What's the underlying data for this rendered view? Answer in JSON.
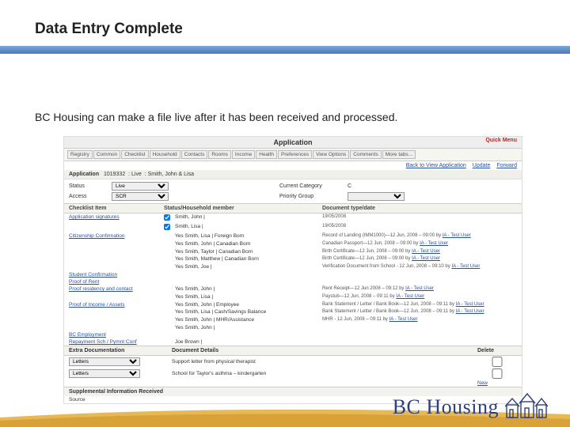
{
  "slide": {
    "title": "Data Entry Complete",
    "body": "BC Housing can make a file live after it has been received and processed."
  },
  "app": {
    "title": "Application",
    "quickMenu": "Quick Menu",
    "tabs": [
      "Registry",
      "Common",
      "Checklist",
      "Household",
      "Contacts",
      "Rooms",
      "Income",
      "Health",
      "Preferences",
      "View Options",
      "Comments",
      "More tabs..."
    ],
    "actions": {
      "back": "Back to View Application",
      "update": "Update",
      "forward": "Forward"
    },
    "info": {
      "label": "Application",
      "id": "1019332",
      "statusWord": "Live",
      "name": "Smith, John & Lisa"
    },
    "fields": {
      "statusLabel": "Status",
      "statusValue": "Live",
      "accessLabel": "Access",
      "accessValue": "SCR",
      "catLabel": "Current Category",
      "catValue": "C",
      "priorityLabel": "Priority Group",
      "priorityValue": ""
    }
  },
  "checklist": {
    "headers": {
      "item": "Checklist\nItem",
      "status": "Status/Household member",
      "doc": "Document type/date"
    },
    "rows": [
      {
        "label": "Application signatures",
        "members": [
          "Smith, John |",
          "Smith, Lisa |"
        ],
        "checks": [
          true,
          true
        ],
        "docs": [
          "19/05/2008",
          "19/05/2008"
        ]
      },
      {
        "label": "Citizenship Confirmation",
        "members": [
          "Yes   Smith, Lisa | Foreign Born",
          "Yes   Smith, John | Canadian Born",
          "Yes   Smith, Taylor | Canadian Born",
          "Yes   Smith, Matthew | Canadian Born",
          "Yes   Smith, Joe |"
        ],
        "docs": [
          "Record of Landing (IMM1000)—12 Jun, 2008 – 09:00 by  IA - Test User",
          "Canadian Passport—12 Jun, 2008 – 09:00 by  IA - Test User",
          "Birth Certificate—12 Jun, 2008 – 09:00 by  IA - Test User",
          "Birth Certificate—12 Jun, 2008 – 09:00 by  IA - Test User",
          "Verification Document from School - 12 Jun, 2008 – 09:10 by  IA - Test User"
        ]
      },
      {
        "label": "Student Confirmation",
        "members": [],
        "docs": []
      },
      {
        "label": "Proof of Rent",
        "members": [],
        "docs": []
      },
      {
        "label": "Proof residency and contact",
        "members": [
          "Yes   Smith, John |",
          "Yes   Smith, Lisa |"
        ],
        "docs": [
          "Rent Receipt—12 Jun 2008 – 09:12 by  IA - Test User",
          "Paystub—12 Jun, 2008 – 09:11 by  IA - Test User"
        ]
      },
      {
        "label": "Proof of Income / Assets",
        "members": [
          "Yes   Smith, John | Employee",
          "Yes   Smith, Lisa | Cash/Savings Balance",
          "Yes   Smith, John | MHR/Assistance",
          "Yes   Smith, John |"
        ],
        "docs": [
          "Bank Statement / Letter / Bank Book—12 Jun, 2008 – 09:11 by  IA - Test User",
          "Bank Statement / Letter / Bank Book—12 Jun, 2008 – 09:11 by  IA - Test User",
          "MHR - 12 Jun, 2008 – 09:11 by  IA - Test User",
          ""
        ]
      },
      {
        "label": "BC Employment",
        "members": [],
        "docs": []
      },
      {
        "label": "Repayment Sch / Pymnt Conf",
        "members": [
          "Joe Brown |"
        ],
        "docs": []
      }
    ]
  },
  "extraDoc": {
    "headers": {
      "type": "Extra Documentation",
      "details": "Document Details",
      "del": "Delete"
    },
    "rows": [
      {
        "type": "Letters",
        "details": "Support letter from physical therapist"
      },
      {
        "type": "Letters",
        "details": "School for Taylor's asthma – kindergarten"
      }
    ],
    "newLabel": "New"
  },
  "supplemental": {
    "header": "Supplemental Information Received",
    "sourceLabel": "Source"
  },
  "footer": {
    "brand": "BC Housing"
  }
}
